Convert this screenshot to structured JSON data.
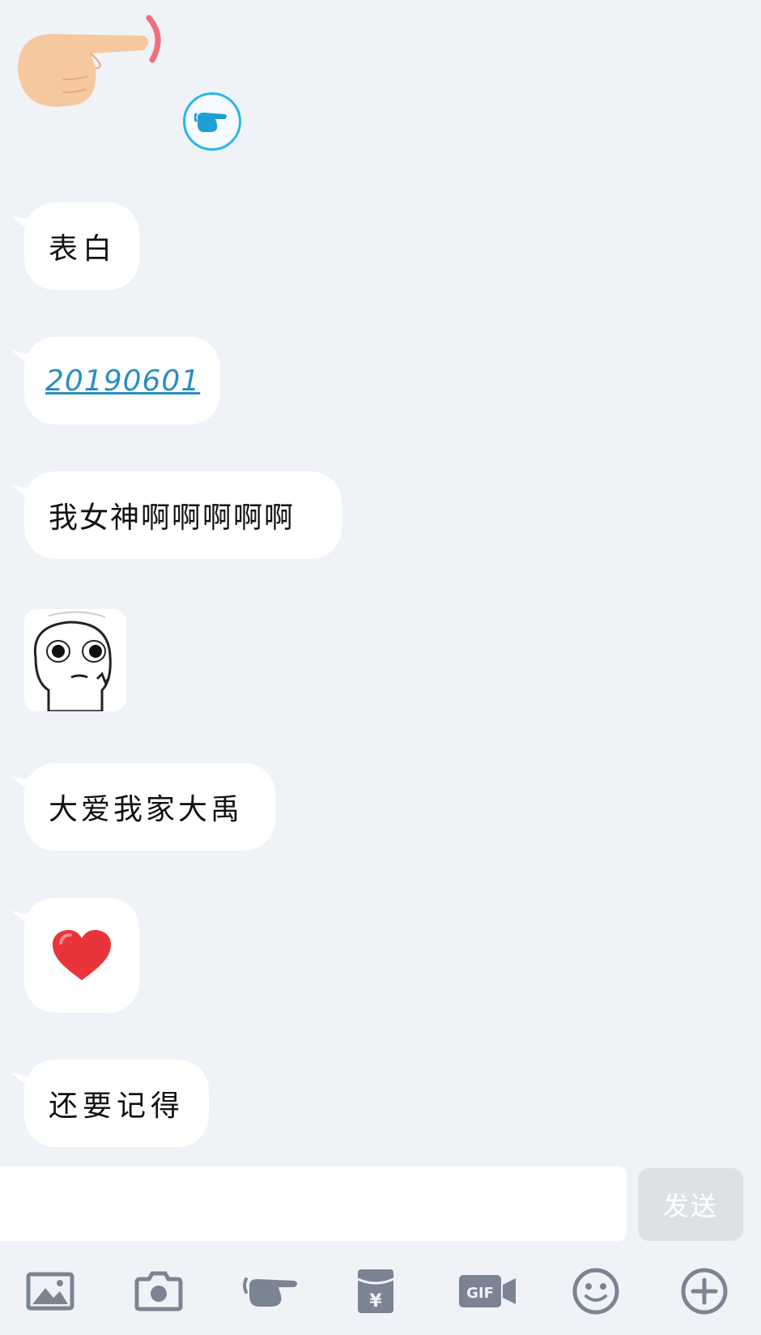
{
  "messages": [
    {
      "type": "text",
      "text": "表白"
    },
    {
      "type": "link",
      "text": "20190601"
    },
    {
      "type": "text",
      "text": "我女神啊啊啊啊啊"
    },
    {
      "type": "sticker",
      "icon": "meme-face-icon"
    },
    {
      "type": "text",
      "text": "大爱我家大禹"
    },
    {
      "type": "emoji",
      "icon": "heart-icon"
    },
    {
      "type": "text",
      "text": "还要记得"
    }
  ],
  "input": {
    "value": "",
    "placeholder": ""
  },
  "send_button": {
    "label": "发送"
  },
  "toolbar": [
    {
      "icon": "image-icon"
    },
    {
      "icon": "camera-icon"
    },
    {
      "icon": "poke-icon"
    },
    {
      "icon": "red-packet-icon",
      "glyph": "¥"
    },
    {
      "icon": "gif-icon",
      "glyph": "GIF"
    },
    {
      "icon": "emoji-icon"
    },
    {
      "icon": "plus-icon"
    }
  ],
  "colors": {
    "background": "#eff3f8",
    "link": "#2a8ec1",
    "accent": "#29b6e8",
    "heart": "#e8343a",
    "toolbar_icon": "#7b8492",
    "send_button": "#dde1e6"
  }
}
